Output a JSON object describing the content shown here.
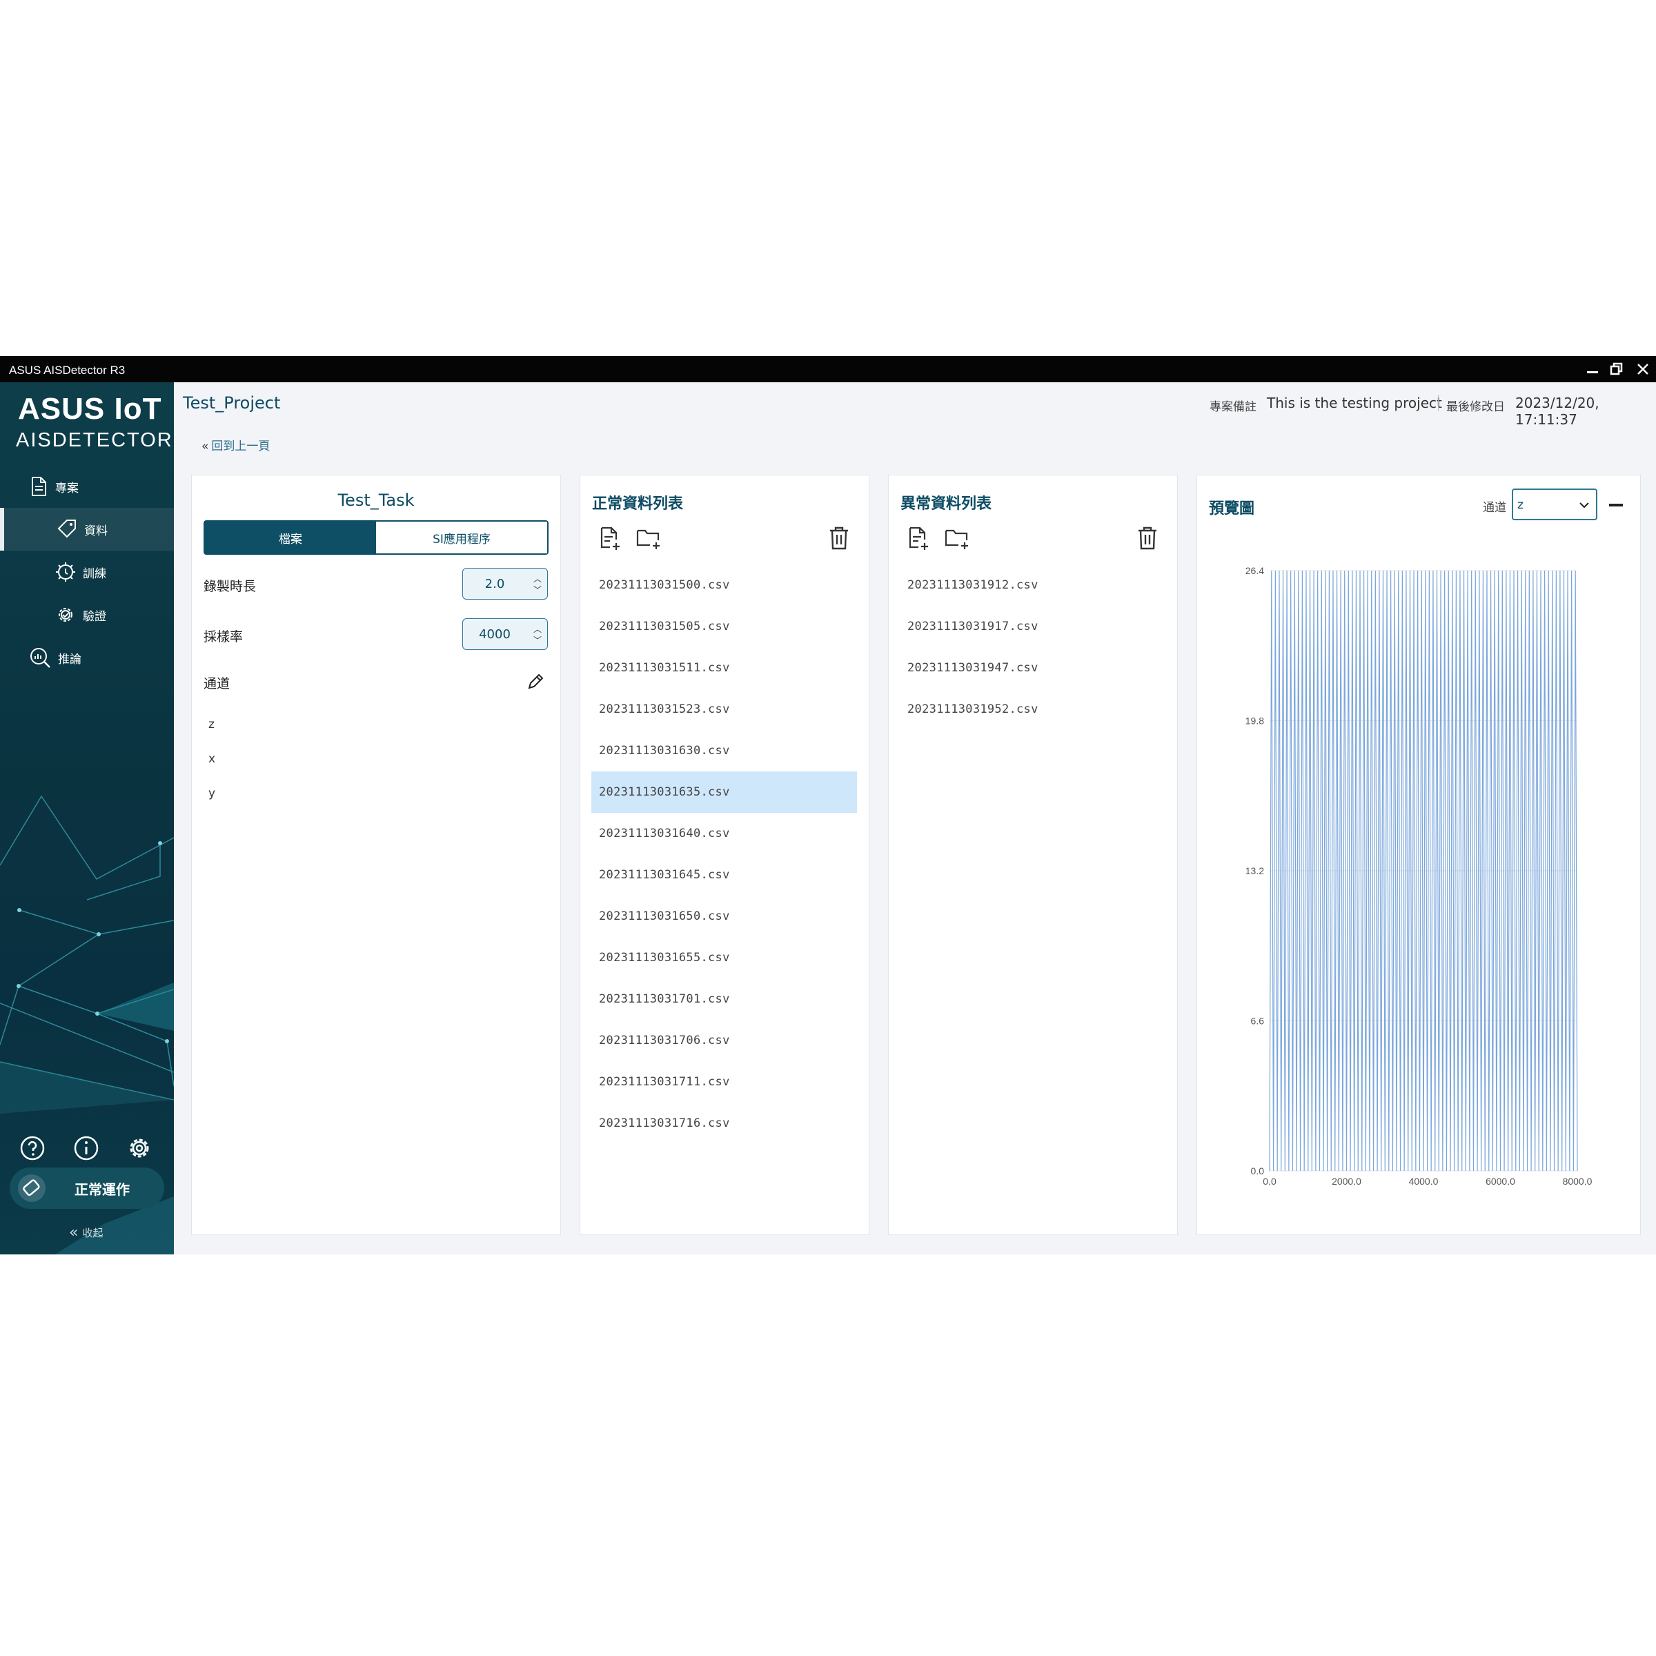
{
  "window": {
    "title": "ASUS AISDetector R3"
  },
  "brand": {
    "line1": "ASUS IoT",
    "line2": "AISDETECTOR"
  },
  "nav": [
    {
      "label": "專案",
      "icon": "document-icon"
    },
    {
      "label": "資料",
      "icon": "tag-icon",
      "active": true
    },
    {
      "label": "訓練",
      "icon": "train-icon"
    },
    {
      "label": "驗證",
      "icon": "gear-check-icon"
    },
    {
      "label": "推論",
      "icon": "search-chart-icon"
    }
  ],
  "status": {
    "label": "正常運作"
  },
  "collapse": {
    "label": "收起"
  },
  "header": {
    "project": "Test_Project",
    "note_label": "專案備註",
    "note_value": "This is the testing project",
    "modified_label": "最後修改日",
    "modified_value": "2023/12/20, 17:11:37",
    "back": "回到上一頁"
  },
  "task": {
    "title": "Test_Task",
    "tabs": [
      "檔案",
      "SI應用程序"
    ],
    "duration_label": "錄製時長",
    "duration_value": "2.0",
    "rate_label": "採樣率",
    "rate_value": "4000",
    "channels_label": "通道",
    "channels": [
      "z",
      "x",
      "y"
    ]
  },
  "normal": {
    "title": "正常資料列表",
    "files": [
      "20231113031500.csv",
      "20231113031505.csv",
      "20231113031511.csv",
      "20231113031523.csv",
      "20231113031630.csv",
      "20231113031635.csv",
      "20231113031640.csv",
      "20231113031645.csv",
      "20231113031650.csv",
      "20231113031655.csv",
      "20231113031701.csv",
      "20231113031706.csv",
      "20231113031711.csv",
      "20231113031716.csv"
    ],
    "selected_index": 5
  },
  "abnormal": {
    "title": "異常資料列表",
    "files": [
      "20231113031912.csv",
      "20231113031917.csv",
      "20231113031947.csv",
      "20231113031952.csv"
    ]
  },
  "preview": {
    "title": "預覽圖",
    "channel_label": "通道",
    "channel_value": "z",
    "series_color": "#7aa6dc"
  },
  "chart_data": {
    "type": "line",
    "x_ticks": [
      "0.0",
      "2000.0",
      "4000.0",
      "6000.0",
      "8000.0"
    ],
    "y_ticks": [
      "0.0",
      "6.6",
      "13.2",
      "19.8",
      "26.4"
    ],
    "xlim": [
      0,
      8000
    ],
    "ylim": [
      0,
      26.4
    ],
    "grid": true,
    "oscillation_count": 160,
    "x_end": 8000
  }
}
